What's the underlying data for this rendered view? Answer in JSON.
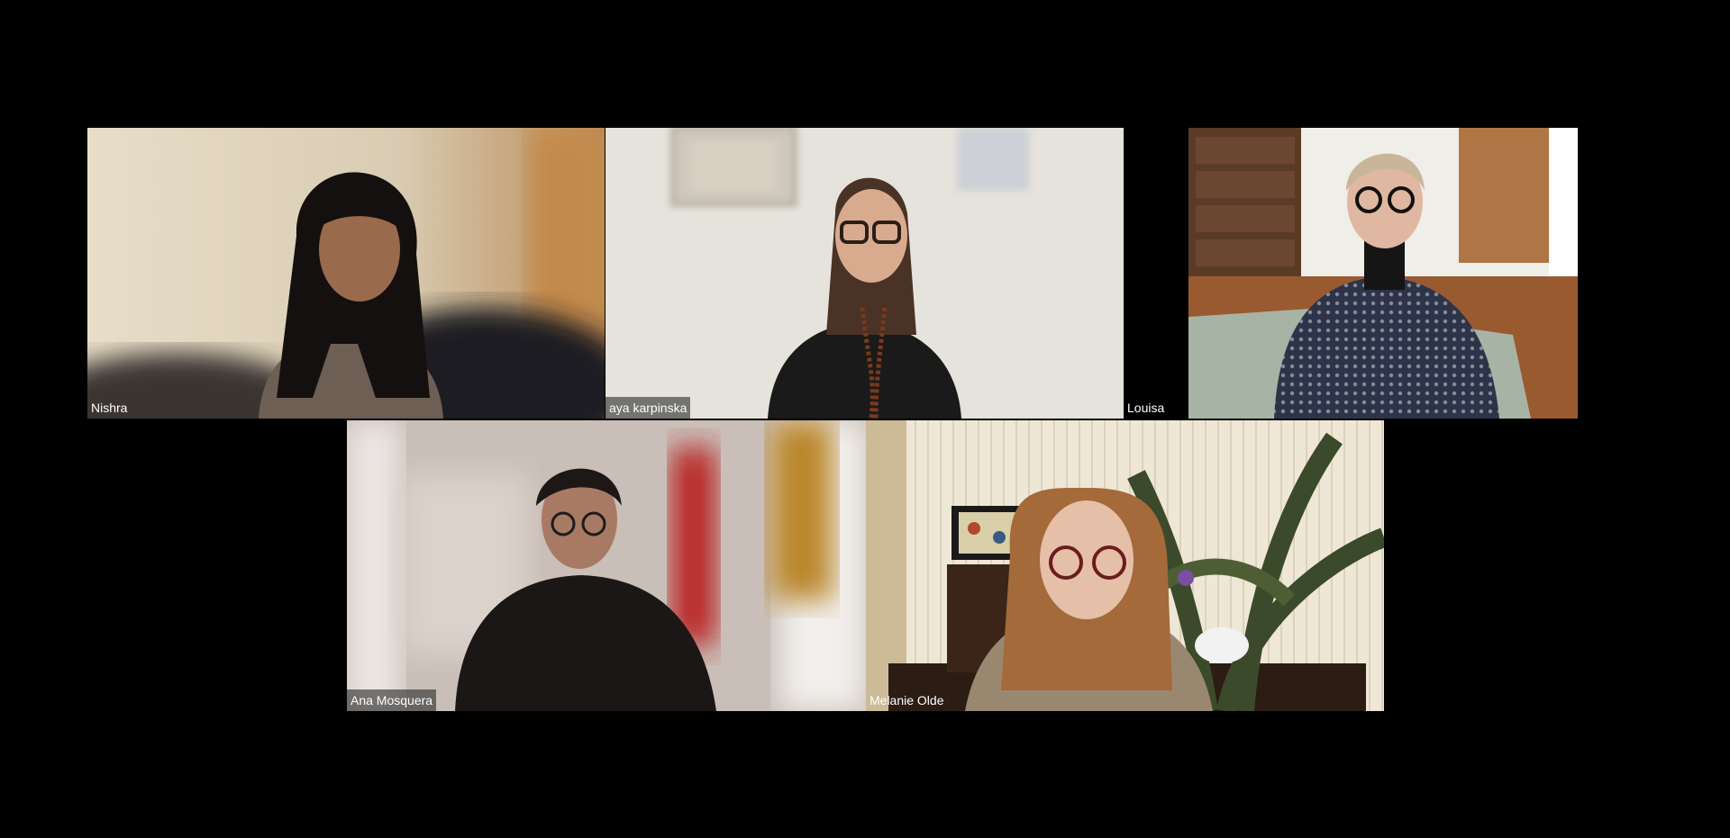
{
  "participants": [
    {
      "name": "Nishra"
    },
    {
      "name": "aya karpinska"
    },
    {
      "name": "Louisa"
    },
    {
      "name": "Ana Mosquera"
    },
    {
      "name": "Melanie Olde"
    }
  ]
}
